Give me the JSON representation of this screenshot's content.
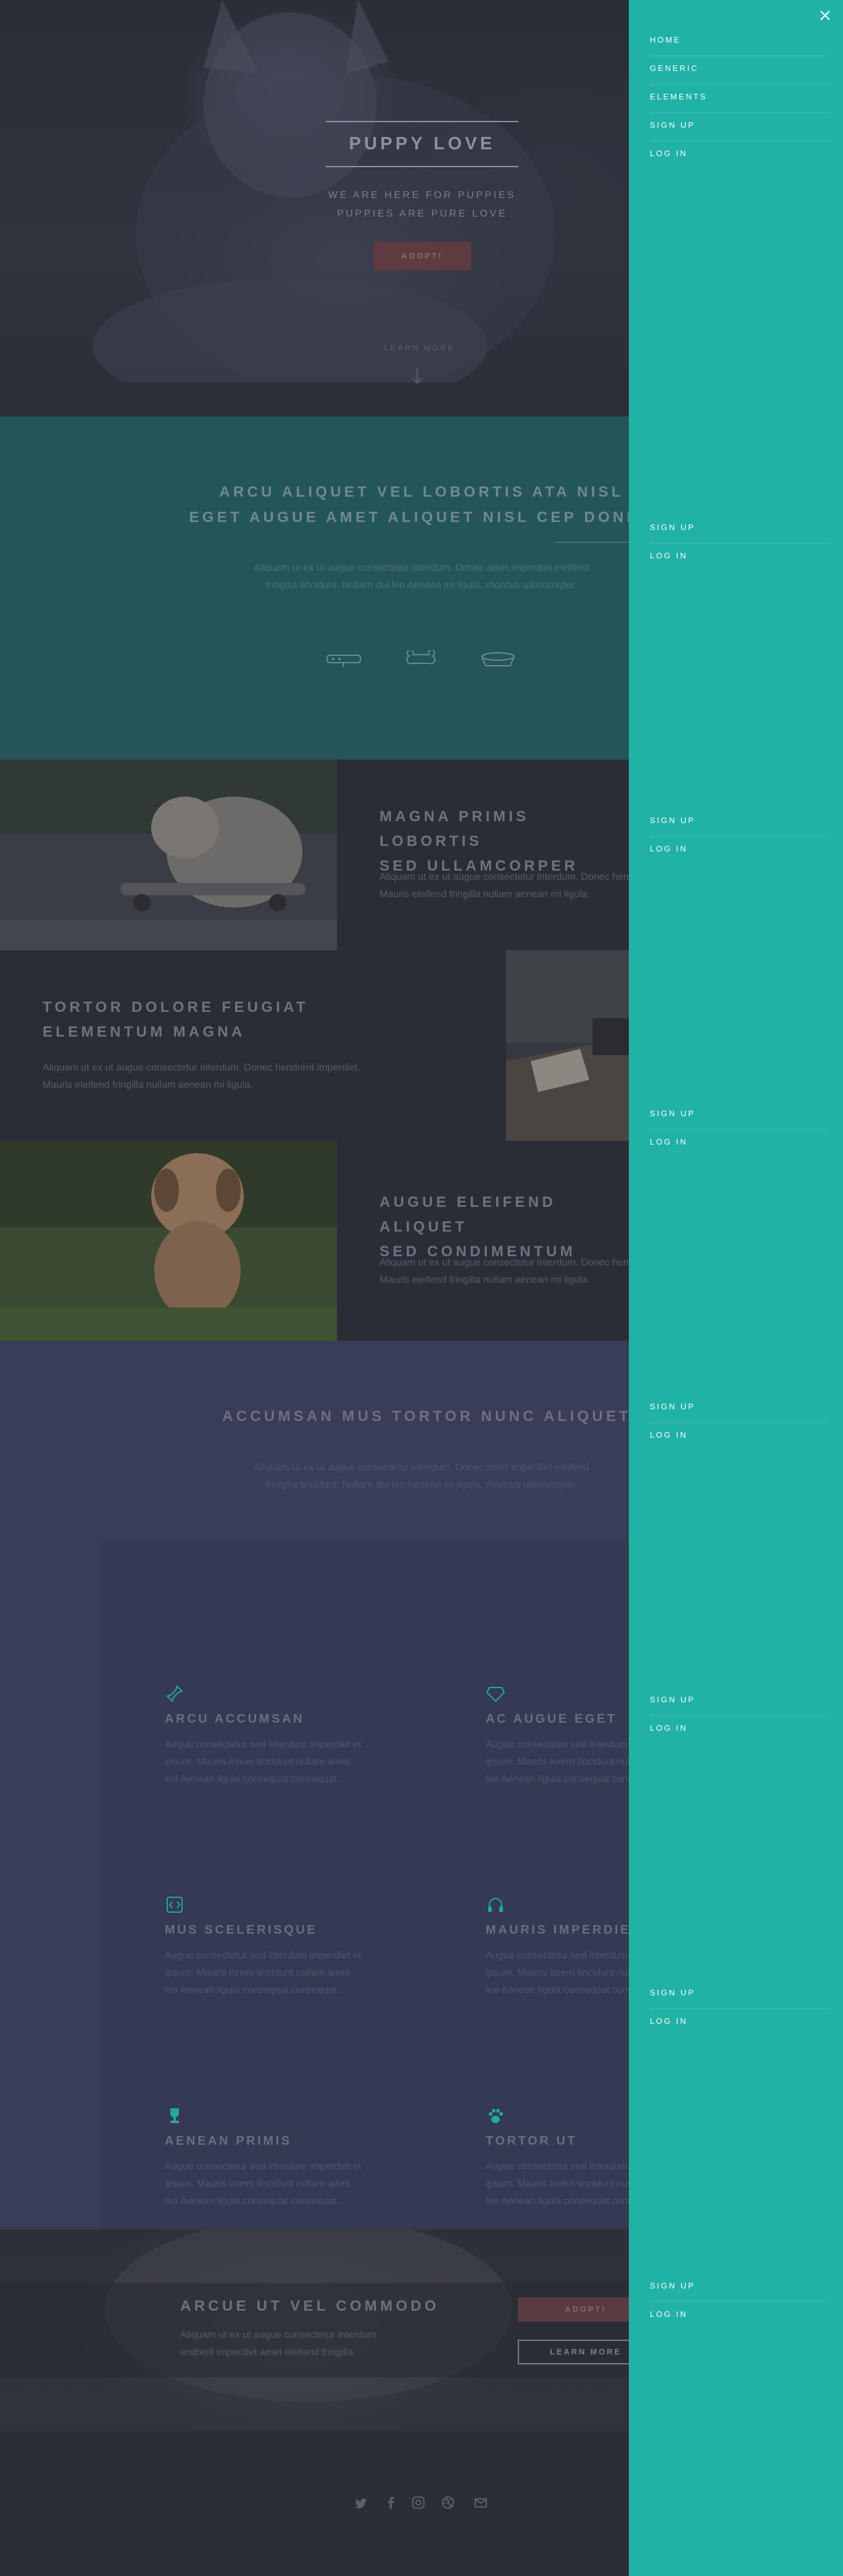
{
  "banner": {
    "title": "PUPPY LOVE",
    "subtitle_line1": "WE ARE HERE FOR PUPPIES",
    "subtitle_line2": "PUPPIES ARE PURE LOVE",
    "button": "ADOPT!",
    "learn_more": "LEARN MORE"
  },
  "intro": {
    "heading_line1": "ARCU ALIQUET VEL LOBORTIS ATA NISL",
    "heading_line2": "EGET AUGUE AMET ALIQUET NISL CEP DONEC",
    "text_line1": "Aliquam ut ex ut augue consectetur interdum. Donec amet imperdiet eleifend",
    "text_line2": "fringilla tincidunt. Nullam dui leo Aenean mi ligula, rhoncus ullamcorper.",
    "icons": [
      "leash-icon",
      "bone-icon",
      "dog-bowl-icon"
    ]
  },
  "spotlights": [
    {
      "heading_line1": "MAGNA PRIMIS LOBORTIS",
      "heading_line2": "SED ULLAMCORPER",
      "text_line1": "Aliquam ut ex ut augue consectetur interdum. Donec hendrerit imperdiet.",
      "text_line2": "Mauris eleifend fringilla nullam aenean mi ligula."
    },
    {
      "heading_line1": "TORTOR DOLORE FEUGIAT",
      "heading_line2": "ELEMENTUM MAGNA",
      "text_line1": "Aliquam ut ex ut augue consectetur interdum. Donec hendrerit imperdiet.",
      "text_line2": "Mauris eleifend fringilla nullam aenean mi ligula."
    },
    {
      "heading_line1": "AUGUE ELEIFEND ALIQUET",
      "heading_line2": "SED CONDIMENTUM",
      "text_line1": "Aliquam ut ex ut augue consectetur interdum. Donec hendrerit imperdiet.",
      "text_line2": "Mauris eleifend fringilla nullam aenean mi ligula."
    }
  ],
  "features": {
    "heading": "ACCUMSAN MUS TORTOR NUNC ALIQUET",
    "text_line1": "Aliquam ut ex ut augue consectetur interdum. Donec amet imperdiet eleifend",
    "text_line2": "fringilla tincidunt. Nullam dui leo Aenean mi ligula, rhoncus ullamcorper.",
    "items": [
      {
        "title": "ARCU ACCUMSAN",
        "icon": "pin-icon",
        "text": "Augue consectetur sed interdum imperdiet et ipsum. Mauris lorem tincidunt nullam amet leo Aenean ligula consequat consequat."
      },
      {
        "title": "AC AUGUE EGET",
        "icon": "diamond-icon",
        "text": "Augue consectetur sed interdum imperdiet et ipsum. Mauris lorem tincidunt nullam amet leo Aenean ligula consequat consequat."
      },
      {
        "title": "MUS SCELERISQUE",
        "icon": "code-icon",
        "text": "Augue consectetur sed interdum imperdiet et ipsum. Mauris lorem tincidunt nullam amet leo Aenean ligula consequat consequat."
      },
      {
        "title": "MAURIS IMPERDIET",
        "icon": "headphones-icon",
        "text": "Augue consectetur sed interdum imperdiet et ipsum. Mauris lorem tincidunt nullam amet leo Aenean ligula consequat consequat."
      },
      {
        "title": "AENEAN PRIMIS",
        "icon": "trophy-icon",
        "text": "Augue consectetur sed interdum imperdiet et ipsum. Mauris lorem tincidunt nullam amet leo Aenean ligula consequat consequat."
      },
      {
        "title": "TORTOR UT",
        "icon": "paw-icon",
        "text": "Augue consectetur sed interdum imperdiet et ipsum. Mauris lorem tincidunt nullam amet leo Aenean ligula consequat consequat."
      }
    ]
  },
  "cta": {
    "heading": "ARCUE UT VEL COMMODO",
    "text_line1": "Aliquam ut ex ut augue consectetur interdum",
    "text_line2": "endrerit imperdiet amet eleifend fringilla.",
    "button_primary": "ADOPT!",
    "button_secondary": "LEARN MORE"
  },
  "footer": {
    "social": [
      "twitter-icon",
      "facebook-icon",
      "instagram-icon",
      "dribbble-icon",
      "email-icon"
    ]
  },
  "menu": {
    "items": [
      {
        "label": "HOME"
      },
      {
        "label": "GENERIC"
      },
      {
        "label": "ELEMENTS"
      },
      {
        "label": "SIGN UP"
      },
      {
        "label": "LOG IN"
      }
    ],
    "repeat_items": [
      {
        "label": "SIGN UP"
      },
      {
        "label": "LOG IN"
      }
    ]
  },
  "colors": {
    "menu_bg": "#21b2a6",
    "banner_button": "#5e3b41",
    "intro_bg": "#24555a",
    "features_bg": "#393d56",
    "page_bg": "#2e3141"
  }
}
